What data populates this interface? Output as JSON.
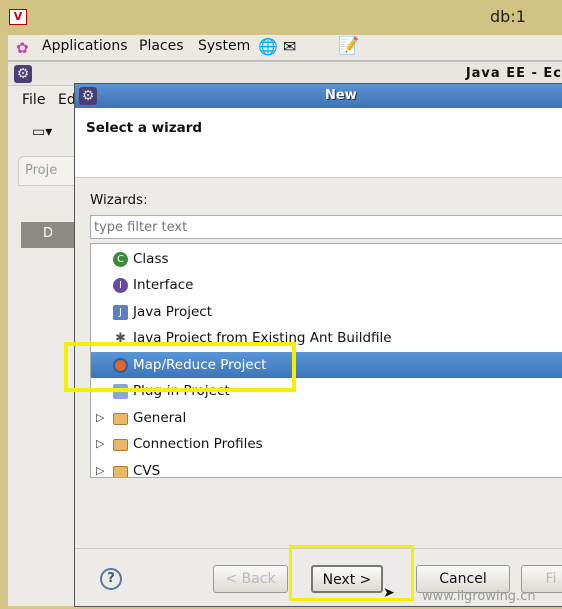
{
  "vnc": {
    "title": "db:1"
  },
  "panel": {
    "menus": [
      "Applications",
      "Places",
      "System"
    ]
  },
  "eclipse": {
    "title": "Java EE - Ec",
    "menus": [
      "File",
      "Ed"
    ],
    "project_tab": "Proje",
    "tree_item": "D"
  },
  "dialog": {
    "title": "New",
    "header": "Select a wizard",
    "wizards_label": "Wizards:",
    "filter_placeholder": "type filter text",
    "items": [
      {
        "label": "Class",
        "icon": "class-icon"
      },
      {
        "label": "Interface",
        "icon": "interface-icon"
      },
      {
        "label": "Java Project",
        "icon": "java-project-icon"
      },
      {
        "label": "Java Project from Existing Ant Buildfile",
        "icon": "ant-icon"
      },
      {
        "label": "Map/Reduce Project",
        "icon": "mapreduce-icon",
        "selected": true
      },
      {
        "label": "Plug-in Project",
        "icon": "plugin-icon"
      },
      {
        "label": "General",
        "icon": "folder-icon",
        "expandable": true
      },
      {
        "label": "Connection Profiles",
        "icon": "folder-icon",
        "expandable": true
      },
      {
        "label": "CVS",
        "icon": "folder-icon",
        "expandable": true
      }
    ],
    "buttons": {
      "back": "< Back",
      "next": "Next >",
      "cancel": "Cancel",
      "finish": "Fi"
    }
  },
  "watermark": "www.ilgrowing.cn",
  "colors": {
    "selection": "#4a86c8",
    "highlight": "#f5ef00",
    "titlebar": "#4a84c6"
  }
}
